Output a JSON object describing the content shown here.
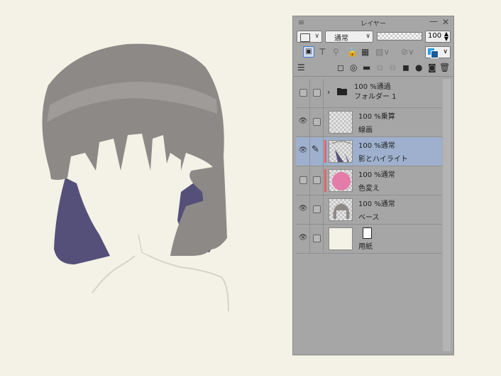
{
  "panel": {
    "title": "レイヤー",
    "blend_mode": "通常",
    "opacity": "100",
    "icons": {
      "menu": "≡",
      "minimize": "—",
      "close": "✕"
    }
  },
  "toolbar": {
    "tools": [
      "clip-icon",
      "ruler-icon",
      "ref-icon",
      "lock-icon",
      "lock-alpha-icon",
      "mask-icon",
      "ruler-off-icon"
    ]
  },
  "layers": [
    {
      "type": "folder",
      "visible": false,
      "mode": "100 %通過",
      "name": "フォルダー 1"
    },
    {
      "type": "layer",
      "visible": true,
      "mode": "100 %乗算",
      "name": "線画",
      "thumb": "checker"
    },
    {
      "type": "layer",
      "visible": true,
      "selected": true,
      "mode": "100 %通常",
      "name": "影とハイライト",
      "thumb": "shadow",
      "marker": true
    },
    {
      "type": "layer",
      "visible": false,
      "mode": "100 %通常",
      "name": "色変え",
      "thumb": "pink",
      "marker": true
    },
    {
      "type": "layer",
      "visible": true,
      "mode": "100 %通常",
      "name": "ベース",
      "thumb": "base"
    },
    {
      "type": "paper",
      "visible": true,
      "mode": "",
      "name": "用紙",
      "thumb": "paper"
    }
  ],
  "colors": {
    "canvas": "#f4f1e6",
    "hair": "#8c8987",
    "hair_highlight": "#9e9b98",
    "shadow": "#54507a",
    "selected_row": "#9eb0cd",
    "marker": "#e06666"
  }
}
